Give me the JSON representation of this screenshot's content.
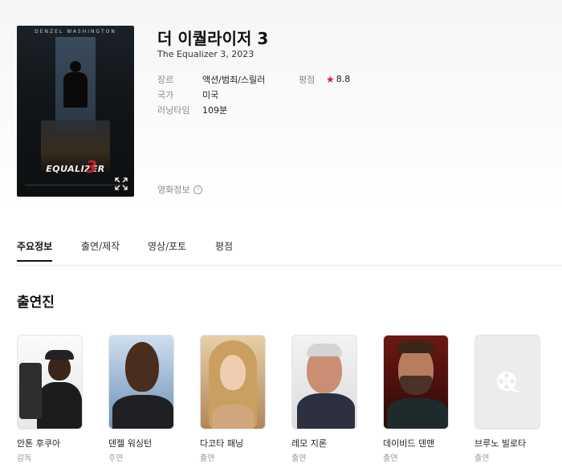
{
  "movie": {
    "title": "더 이퀄라이저 3",
    "subtitle": "The Equalizer 3, 2023",
    "info": [
      {
        "label": "장르",
        "value": "액션/범죄/스릴러"
      },
      {
        "label": "국가",
        "value": "미국"
      },
      {
        "label": "러닝타임",
        "value": "109분"
      }
    ],
    "rating": {
      "label": "평점",
      "value": "8.8",
      "star_color": "#e51937"
    },
    "more_info": "영화정보",
    "more_info_icon": "info-circle-icon",
    "poster": {
      "top_credit": "DENZEL WASHINGTON",
      "logo": "EQUALIZER",
      "logo_number": "3",
      "expand_icon": "expand-icon"
    }
  },
  "tabs": [
    {
      "label": "주요정보",
      "active": true
    },
    {
      "label": "출연/제작",
      "active": false
    },
    {
      "label": "영상/포토",
      "active": false
    },
    {
      "label": "평점",
      "active": false
    }
  ],
  "cast_section": {
    "title": "출연진",
    "members": [
      {
        "name": "안톤 후쿠아",
        "role": "감독"
      },
      {
        "name": "덴젤 워싱턴",
        "role": "주연"
      },
      {
        "name": "다코타 패닝",
        "role": "출연"
      },
      {
        "name": "레모 지론",
        "role": "출연"
      },
      {
        "name": "데이비드 덴맨",
        "role": "출연"
      },
      {
        "name": "브루노 빌로타",
        "role": "출연",
        "placeholder_icon": "film-reel-icon"
      }
    ]
  }
}
